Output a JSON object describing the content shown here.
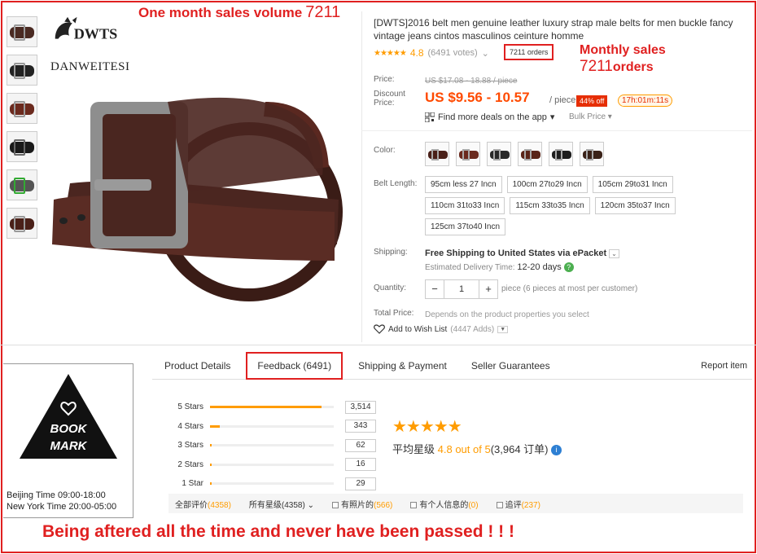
{
  "annotations": {
    "top_label": "One month sales volume",
    "top_number": "7211",
    "side_label": "Monthly sales",
    "side_number": "7211",
    "side_suffix": "orders",
    "bottom": "Being aftered all the time and never have been passed ! ! !"
  },
  "brand": {
    "logo_text": "DWTS",
    "name": "DANWEITESI"
  },
  "product": {
    "title": "[DWTS]2016 belt men genuine leather luxury strap male belts for men buckle fancy vintage jeans cintos masculinos ceinture homme",
    "stars": "★★★★★",
    "rating": "4.8",
    "votes": "(6491 votes)",
    "orders": "7211 orders"
  },
  "price": {
    "price_label": "Price:",
    "old": "US $17.08 - 18.88 / piece",
    "discount_label_1": "Discount",
    "discount_label_2": "Price:",
    "current": "US $9.56 - 10.57",
    "unit": "/ piece",
    "off": "44% off",
    "timer": "17h:01m:11s",
    "deals": "Find more deals on the app",
    "bulk": "Bulk Price"
  },
  "options": {
    "color_label": "Color:",
    "swatch_colors": [
      "#4a2018",
      "#6b2a1e",
      "#2a2a2a",
      "#5a2418",
      "#1e1e1e",
      "#3a2218"
    ],
    "length_label": "Belt Length:",
    "lengths": [
      "95cm less 27 Incn",
      "100cm 27to29 Incn",
      "105cm 29to31 Incn",
      "110cm 31to33 Incn",
      "115cm 33to35 Incn",
      "120cm 35to37 Incn",
      "125cm 37to40 Incn"
    ]
  },
  "shipping": {
    "label": "Shipping:",
    "value": "Free Shipping to United States via ePacket",
    "est_label": "Estimated Delivery Time:",
    "est_value": "12-20 days"
  },
  "quantity": {
    "label": "Quantity:",
    "minus": "−",
    "value": "1",
    "plus": "+",
    "note": "piece (6 pieces at most per customer)"
  },
  "total": {
    "label": "Total Price:",
    "value": "Depends on the product properties you select"
  },
  "wishlist": {
    "label": "Add to Wish List",
    "count": "(4447 Adds)"
  },
  "bookmark": {
    "line1": "BOOK",
    "line2": "MARK"
  },
  "hours": {
    "beijing": "Beijing Time 09:00-18:00",
    "newyork": "New York Time 20:00-05:00"
  },
  "tabs": {
    "details": "Product Details",
    "feedback": "Feedback (6491)",
    "shipping": "Shipping & Payment",
    "guarantees": "Seller Guarantees",
    "report": "Report item"
  },
  "feedback": {
    "rows": [
      {
        "label": "5 Stars",
        "count": "3,514",
        "fraction": 0.9
      },
      {
        "label": "4 Stars",
        "count": "343",
        "fraction": 0.08
      },
      {
        "label": "3 Stars",
        "count": "62",
        "fraction": 0.015
      },
      {
        "label": "2 Stars",
        "count": "16",
        "fraction": 0.008
      },
      {
        "label": "1 Star",
        "count": "29",
        "fraction": 0.008
      }
    ],
    "avg_stars": "★★★★★",
    "avg_label": "平均星级",
    "avg_value": "4.8 out of 5",
    "avg_count": "(3,964 订单)"
  },
  "filters": {
    "all_label": "全部评价",
    "all_count": "(4358)",
    "stars_label": "所有星级",
    "stars_count": "(4358)",
    "photo_label": "有照片的",
    "photo_count": "(566)",
    "personal_label": "有个人信息的",
    "personal_count": "(0)",
    "extra_label": "追评",
    "extra_count": "(237)"
  },
  "colors": {
    "accent": "#ff4a00",
    "star": "#ff9c00",
    "annotation": "#e02020",
    "belt": "#4b2620"
  }
}
